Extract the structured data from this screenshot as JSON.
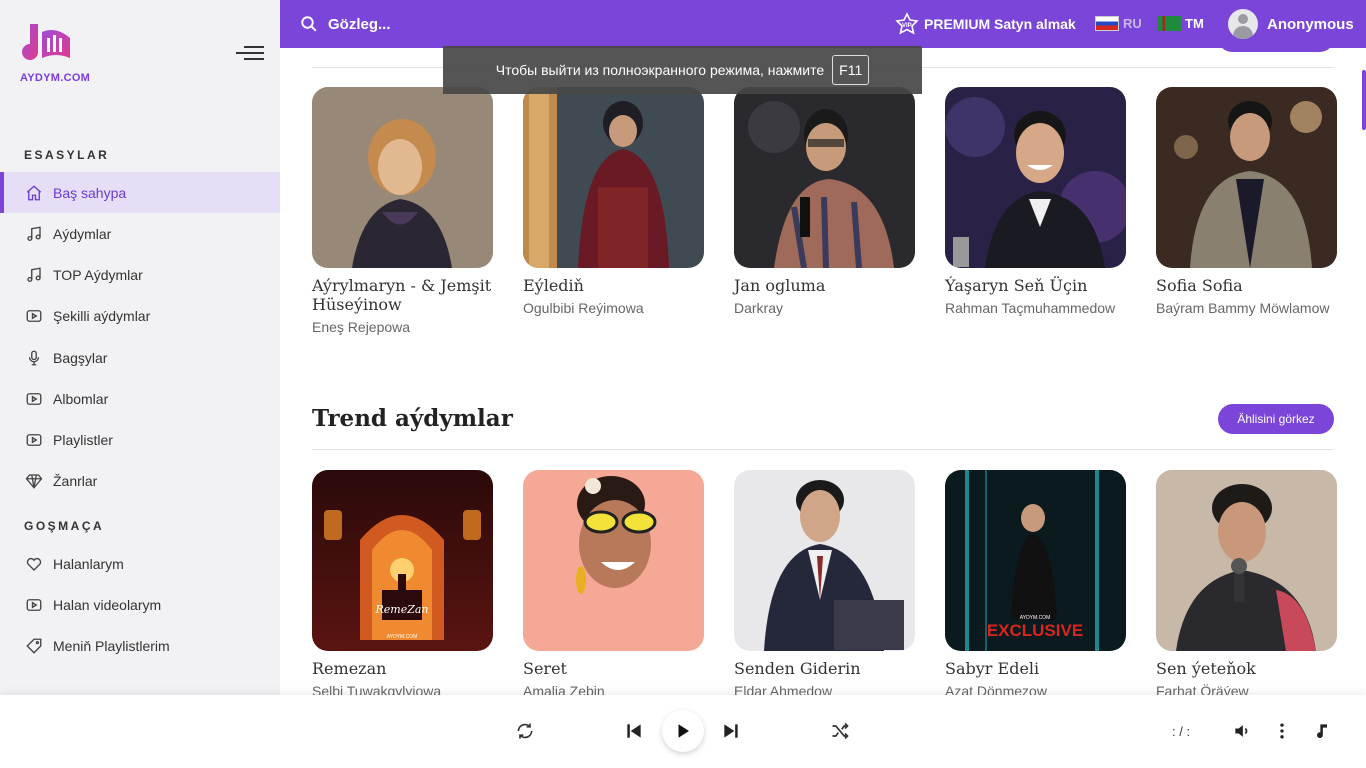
{
  "brand": {
    "logo_text": "AYDYM.COM",
    "accent": "#7a45d8"
  },
  "sidebar": {
    "section1": "ESASYLAR",
    "section2": "GOŞMAÇA",
    "items": [
      {
        "label": "Baş sahypa",
        "icon": "home-icon",
        "active": true
      },
      {
        "label": "Aýdymlar",
        "icon": "music-note-icon"
      },
      {
        "label": "TOP Aýdymlar",
        "icon": "music-note-icon"
      },
      {
        "label": "Şekilli aýdymlar",
        "icon": "video-icon"
      },
      {
        "label": "Bagşylar",
        "icon": "microphone-icon"
      },
      {
        "label": "Albomlar",
        "icon": "play-box-icon"
      },
      {
        "label": "Playlistler",
        "icon": "play-box-icon"
      },
      {
        "label": "Žanrlar",
        "icon": "diamond-icon"
      }
    ],
    "items2": [
      {
        "label": "Halanlarym",
        "icon": "heart-icon"
      },
      {
        "label": "Halan videolarym",
        "icon": "video-icon"
      },
      {
        "label": "Meniň Playlistlerim",
        "icon": "tag-icon"
      }
    ]
  },
  "topbar": {
    "search_placeholder": "Gözleg...",
    "premium_label": "PREMIUM Satyn almak",
    "lang_ru": "RU",
    "lang_tm": "TM",
    "user_name": "Anonymous"
  },
  "toast": {
    "text": "Чтобы выйти из полноэкранного режима, нажмите",
    "key": "F11"
  },
  "section_top": {
    "cards": [
      {
        "title": "Aýrylmaryn - & Jemşit Hüseýinow",
        "artist": "Eneş Rejepowa"
      },
      {
        "title": "Eýlediň",
        "artist": "Ogulbibi Reýimowa"
      },
      {
        "title": "Jan ogluma",
        "artist": "Darkray"
      },
      {
        "title": "Ýaşaryn Seň Üçin",
        "artist": "Rahman Taçmuhammedow"
      },
      {
        "title": "Sofia Sofia",
        "artist": "Baýram Bammy Möwlamow"
      }
    ]
  },
  "section_trend": {
    "title": "Trend aýdymlar",
    "more_label": "Ählisini görkez",
    "cards": [
      {
        "title": "Remezan",
        "artist": "Selbi Tuwakgylyjowa",
        "cover_text": "RemeZan",
        "cover_small": "AYDYM.COM"
      },
      {
        "title": "Seret",
        "artist": "Amalia Zebin"
      },
      {
        "title": "Senden Giderin",
        "artist": "Eldar Ahmedow"
      },
      {
        "title": "Sabyr Edeli",
        "artist": "Azat Dönmezow",
        "cover_text": "EXCLUSIVE",
        "cover_small": "AYDYM.COM"
      },
      {
        "title": "Sen ýeteňok",
        "artist": "Farhat Öräýew"
      }
    ]
  },
  "player": {
    "time": ": / :"
  }
}
